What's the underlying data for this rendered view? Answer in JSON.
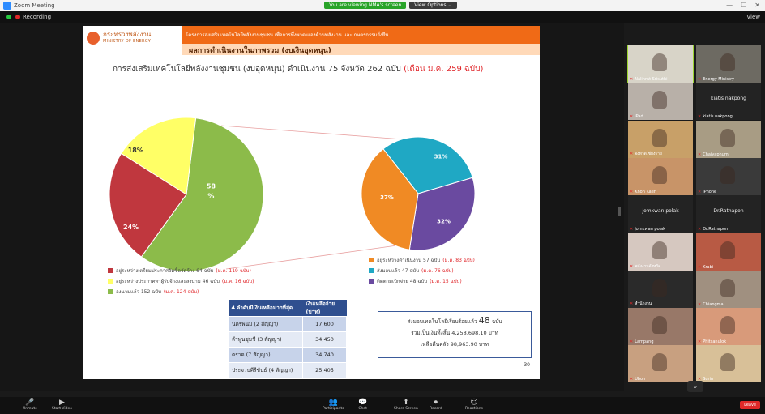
{
  "window": {
    "title": "Zoom Meeting",
    "center_green": "You are viewing NMA's screen",
    "center_dark": "View Options ⌄",
    "controls": [
      "—",
      "☐",
      "✕"
    ]
  },
  "meeting_bar": {
    "recording_label": "Recording",
    "view_label": "View"
  },
  "slide": {
    "logo_th": "กระทรวงพลังงาน",
    "logo_en": "MINISTRY OF ENERGY",
    "strip_text": "โครงการส่งเสริมเทคโนโลยีพลังงานชุมชน เพื่อการพึ่งพาตนเองด้านพลังงาน และเกษตรกรรมยั่งยืน",
    "section_title": "ผลการดำเนินงานในภาพรวม (งบเงินอุดหนุน)",
    "main_title": "การส่งเสริมเทคโนโลยีพลังงานชุมชน (งบอุดหนุน) ดำเนินงาน 75 จังหวัด 262 ฉบับ",
    "main_title_highlight": "(เดือน ม.ค. 259 ฉบับ)",
    "page_number": "30",
    "left_legend": [
      {
        "label": "อยู่ระหว่างเตรียมประกาศจัดซื้อจัดจ้าง 64 ฉบับ",
        "note": "(ม.ค. 119 ฉบับ)",
        "color": "#c0373e"
      },
      {
        "label": "อยู่ระหว่างประกาศหาผู้รับจ้างและลงนาม 46 ฉบับ",
        "note": "(ม.ค. 16 ฉบับ)",
        "color": "#ffff66"
      },
      {
        "label": "ลงนามแล้ว 152 ฉบับ",
        "note": "(ม.ค. 124 ฉบับ)",
        "color": "#8cbb4a"
      }
    ],
    "right_legend": [
      {
        "label": "อยู่ระหว่างดำเนินงาน 57 ฉบับ",
        "note": "(ม.ค. 83 ฉบับ)",
        "color": "#f08a24"
      },
      {
        "label": "ส่งมอบแล้ว 47 ฉบับ",
        "note": "(ม.ค. 76 ฉบับ)",
        "color": "#1fa8c4"
      },
      {
        "label": "ติดตามเบิกจ่าย 48 ฉบับ",
        "note": "(ม.ค. 15 ฉบับ)",
        "color": "#6a4aa0"
      }
    ],
    "table": {
      "headers": [
        "4 ลำดับมีเงินเหลือมากที่สุด",
        "เงินเหลือจ่าย (บาท)"
      ],
      "rows": [
        {
          "name": "นครพนม (2 สัญญา)",
          "value": "17,600"
        },
        {
          "name": "ลำพูนชุมชี (3 สัญญา)",
          "value": "34,450"
        },
        {
          "name": "ตราด (7 สัญญา)",
          "value": "34,740"
        },
        {
          "name": "ประจวบคีรีขันธ์ (4 สัญญา)",
          "value": "25,405"
        }
      ]
    },
    "infobox": {
      "line1": "ส่งมอบเทคโนโลยีเรียบร้อยแล้ว",
      "line1_big": "48",
      "line1_suffix": "ฉบับ",
      "line2": "รวมเป็นเงินทั้งสิ้น 4,258,698.10 บาท",
      "line3": "เหลือคืนคลัง 98,963.90 บาท"
    }
  },
  "chart_data": [
    {
      "type": "pie",
      "series": [
        {
          "values": [
            58,
            24,
            18
          ]
        }
      ],
      "labels": [
        "58 %",
        "24%",
        "18%"
      ],
      "colors": [
        "#8cbb4a",
        "#c0373e",
        "#ffff66"
      ]
    },
    {
      "type": "pie",
      "series": [
        {
          "values": [
            31,
            32,
            37
          ]
        }
      ],
      "labels": [
        "31%",
        "32%",
        "37%"
      ],
      "colors": [
        "#1fa8c4",
        "#6a4aa0",
        "#f08a24"
      ]
    }
  ],
  "gallery": {
    "tiles": [
      {
        "name": "Nalinrat Srisuthi",
        "kind": "video",
        "active": true,
        "bg": "#d8d4c8"
      },
      {
        "name": "Energy Ministry",
        "kind": "video",
        "active": false,
        "bg": "#6d6a62"
      },
      {
        "name": "iPad",
        "kind": "video",
        "active": false,
        "bg": "#b8b0a8"
      },
      {
        "name": "kiatis nakpong",
        "kind": "name",
        "active": false
      },
      {
        "name": "จังหวัดเชียงราย",
        "kind": "video",
        "active": false,
        "bg": "#c8a068"
      },
      {
        "name": "Chaiyaphum",
        "kind": "video",
        "active": false,
        "bg": "#a89c84"
      },
      {
        "name": "Khon Kaen",
        "kind": "video",
        "active": false,
        "bg": "#c89468"
      },
      {
        "name": "iPhone",
        "kind": "video",
        "active": false,
        "bg": "#3a3a3a"
      },
      {
        "name": "Jomkwan polak",
        "kind": "name",
        "active": false
      },
      {
        "name": "Dr.Rathapon",
        "kind": "name",
        "active": false
      },
      {
        "name": "พลังงานจังหวัด",
        "kind": "video",
        "active": false,
        "bg": "#d6c8c0"
      },
      {
        "name": "Krabi",
        "kind": "video",
        "active": false,
        "bg": "#b85a44"
      },
      {
        "name": "สำนักงาน",
        "kind": "video",
        "active": false,
        "bg": "#2a2a2a"
      },
      {
        "name": "Chiangmai",
        "kind": "video",
        "active": false,
        "bg": "#a09080"
      },
      {
        "name": "Lampang",
        "kind": "video",
        "active": false,
        "bg": "#987868"
      },
      {
        "name": "Phitsanulok",
        "kind": "video",
        "active": false,
        "bg": "#d89a7a"
      },
      {
        "name": "Ubon",
        "kind": "video",
        "active": false,
        "bg": "#c8a080"
      },
      {
        "name": "Surin",
        "kind": "video",
        "active": false,
        "bg": "#d8c098"
      }
    ],
    "scroll_label": "⌄"
  },
  "toolbar": {
    "left": [
      {
        "icon": "mic-icon",
        "glyph": "🎤",
        "label": "Unmute"
      },
      {
        "icon": "video-icon",
        "glyph": "▶",
        "label": "Start Video"
      }
    ],
    "center": [
      {
        "icon": "participants-icon",
        "glyph": "👥",
        "label": "Participants"
      },
      {
        "icon": "chat-icon",
        "glyph": "💬",
        "label": "Chat"
      },
      {
        "icon": "share-icon",
        "glyph": "⬆",
        "label": "Share Screen"
      },
      {
        "icon": "record-icon",
        "glyph": "⏺",
        "label": "Record"
      },
      {
        "icon": "reactions-icon",
        "glyph": "☺",
        "label": "Reactions"
      }
    ],
    "end_label": "Leave"
  }
}
